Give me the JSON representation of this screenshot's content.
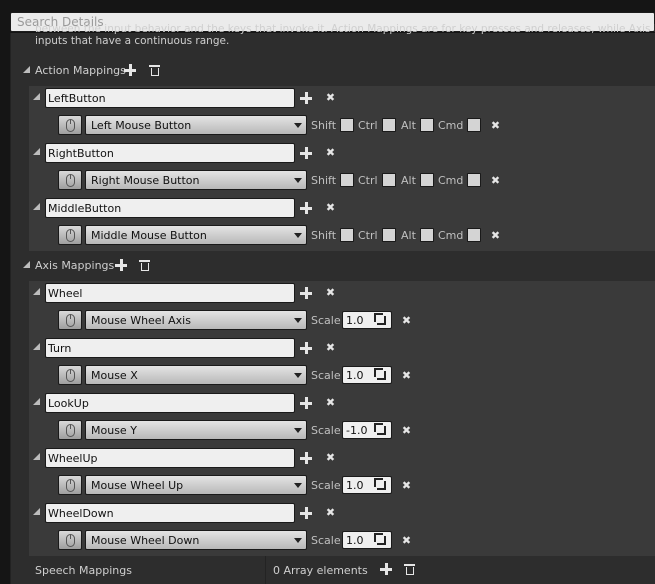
{
  "search": {
    "placeholder": "Search Details"
  },
  "description": {
    "line1": "between the input behavior and the keys that invoke it. Action Mappings are for key presses and releases, while Axis Mappings are for",
    "line2": "inputs that have a continuous range."
  },
  "action_mappings": {
    "label": "Action Mappings",
    "items": [
      {
        "name": "LeftButton",
        "key": "Left Mouse Button",
        "modifiers": [
          "Shift",
          "Ctrl",
          "Alt",
          "Cmd"
        ]
      },
      {
        "name": "RightButton",
        "key": "Right Mouse Button",
        "modifiers": [
          "Shift",
          "Ctrl",
          "Alt",
          "Cmd"
        ]
      },
      {
        "name": "MiddleButton",
        "key": "Middle Mouse Button",
        "modifiers": [
          "Shift",
          "Ctrl",
          "Alt",
          "Cmd"
        ]
      }
    ]
  },
  "axis_mappings": {
    "label": "Axis Mappings",
    "scale_label": "Scale",
    "items": [
      {
        "name": "Wheel",
        "key": "Mouse Wheel Axis",
        "scale": "1.0"
      },
      {
        "name": "Turn",
        "key": "Mouse X",
        "scale": "1.0"
      },
      {
        "name": "LookUp",
        "key": "Mouse Y",
        "scale": "-1.0"
      },
      {
        "name": "WheelUp",
        "key": "Mouse Wheel Up",
        "scale": "1.0"
      },
      {
        "name": "WheelDown",
        "key": "Mouse Wheel Down",
        "scale": "1.0"
      }
    ]
  },
  "speech_mappings": {
    "label": "Speech Mappings",
    "count_text": "0 Array elements"
  },
  "icons": {
    "add": "plus-icon",
    "remove": "x-icon",
    "delete_all": "trash-icon",
    "key_picker": "mouse-icon",
    "expand": "triangle-expanded-icon"
  },
  "colors": {
    "panel": "#2d2d2d",
    "group": "#3a3a3a",
    "field": "#efefef",
    "search_bg": "#ebebeb"
  }
}
